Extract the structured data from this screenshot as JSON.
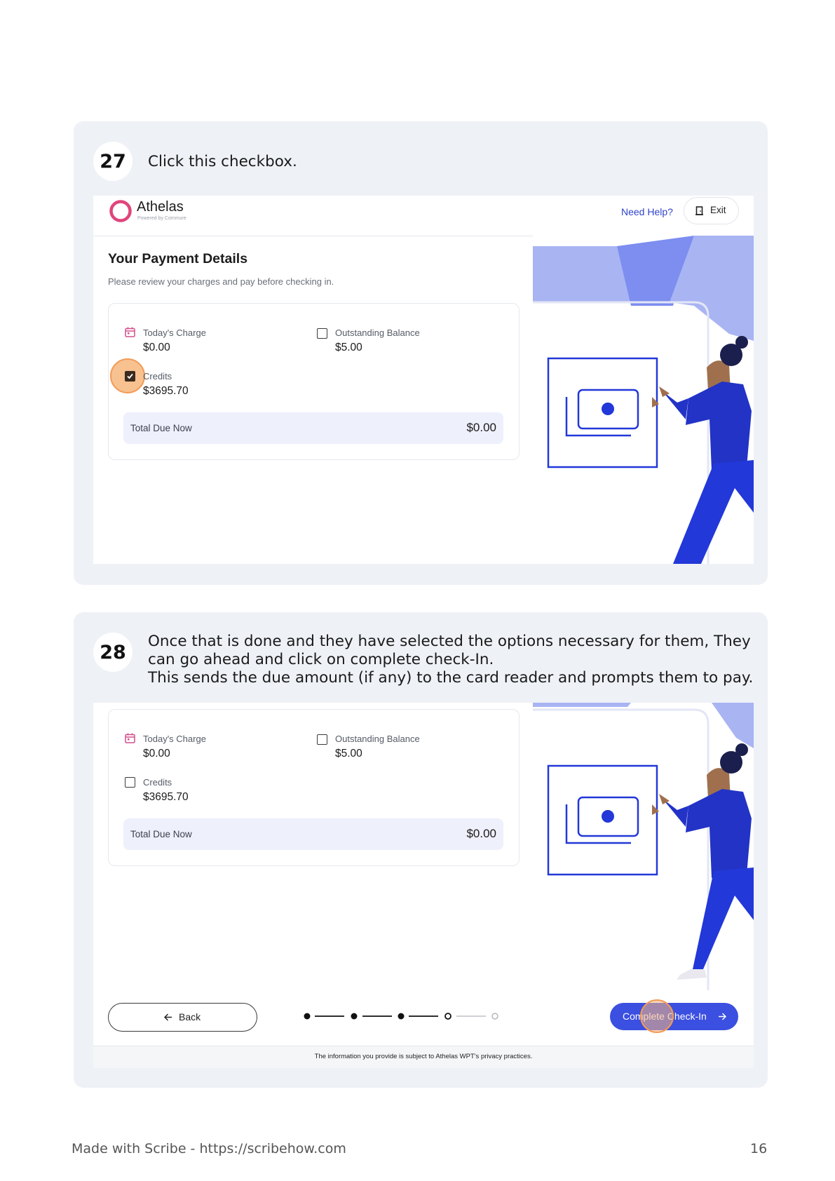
{
  "steps": [
    {
      "number": "27",
      "instruction": "Click this checkbox.",
      "screen": {
        "brand": "Athelas",
        "brand_sub": "Powered by Commure",
        "help_link": "Need Help?",
        "exit_label": "Exit",
        "page_title": "Your Payment Details",
        "page_subtitle": "Please review your charges and pay before checking in.",
        "todays_charge_label": "Today's Charge",
        "todays_charge_value": "$0.00",
        "outstanding_label": "Outstanding Balance",
        "outstanding_value": "$5.00",
        "credits_label": "Credits",
        "credits_value": "$3695.70",
        "credits_checked": true,
        "total_label": "Total Due Now",
        "total_value": "$0.00"
      }
    },
    {
      "number": "28",
      "instruction_lines": [
        "Once that is done and they have selected the options necessary for them, They",
        "can go ahead and click on complete check-In.",
        "This sends the due amount (if any) to the card reader and prompts them to pay."
      ],
      "screen": {
        "todays_charge_label": "Today's Charge",
        "todays_charge_value": "$0.00",
        "outstanding_label": "Outstanding Balance",
        "outstanding_value": "$5.00",
        "credits_label": "Credits",
        "credits_value": "$3695.70",
        "credits_checked": false,
        "total_label": "Total Due Now",
        "total_value": "$0.00",
        "back_label": "Back",
        "complete_label": "Complete Check-In",
        "privacy_note": "The information you provide is subject to Athelas WPT's privacy practices.",
        "progress": {
          "total_steps": 5,
          "completed_steps": 3,
          "current_step": 4
        }
      }
    }
  ],
  "footer": {
    "made_with": "Made with Scribe - https://scribehow.com",
    "page_number": "16"
  },
  "colors": {
    "brand_blue": "#3b4fe0",
    "illustration_blue": "#2238d8",
    "light_blue": "#a9b4f3",
    "brand_pink": "#e0457b",
    "highlight_orange": "#f7b67d"
  },
  "icons": [
    "athelas-logo-icon",
    "exit-door-icon",
    "calendar-icon",
    "arrow-left-icon",
    "arrow-right-icon",
    "cash-icon"
  ]
}
